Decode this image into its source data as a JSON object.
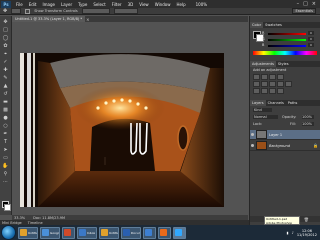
{
  "menubar": {
    "logo": "Ps",
    "items": [
      "File",
      "Edit",
      "Image",
      "Layer",
      "Type",
      "Select",
      "Filter",
      "3D",
      "View",
      "Window",
      "Help"
    ],
    "zoom": "100%"
  },
  "optionsbar": {
    "checkbox_label": "Show Transform Controls",
    "workspace": "Essentials"
  },
  "document": {
    "tab_label": "Untitled-1 @ 33.3% (Layer 1, RGB/8) *",
    "status_zoom": "33.3%",
    "status_doc": "Doc: 11.8M/23.9M",
    "mini_bridge": "Mini Bridge",
    "timeline": "Timeline"
  },
  "panels": {
    "color_tabs": [
      "Color",
      "Swatches"
    ],
    "color_sliders": [
      {
        "label": "R",
        "value": "0",
        "gradient": "#ff0000"
      },
      {
        "label": "G",
        "value": "0",
        "gradient": "#00ff00"
      },
      {
        "label": "B",
        "value": "0",
        "gradient": "#0000ff"
      }
    ],
    "adjust_tabs": [
      "Adjustments",
      "Styles"
    ],
    "adjust_title": "Add an adjustment",
    "layer_tabs": [
      "Layers",
      "Channels",
      "Paths"
    ],
    "kind": "Kind",
    "blend_mode": "Normal",
    "opacity_label": "Opacity:",
    "opacity_value": "100%",
    "lock_label": "Lock:",
    "fill_label": "Fill:",
    "fill_value": "100%",
    "layers": [
      {
        "name": "Layer 1",
        "thumb_color": "#777777",
        "selected": true
      },
      {
        "name": "Background",
        "thumb_color": "#9a4f18",
        "selected": false
      }
    ]
  },
  "taskbar": {
    "items": [
      {
        "label": "Untitled - Paint",
        "icon_color": "#e0a12c"
      },
      {
        "label": "Google - Wind...",
        "icon_color": "#4a90d9"
      },
      {
        "label": "",
        "icon_color": "#d04a2a"
      },
      {
        "label": "Inbox - Outl...",
        "icon_color": "#3b78c6"
      },
      {
        "label": "Untitled - Pai...",
        "icon_color": "#e0a12c"
      },
      {
        "label": "Docum...",
        "icon_color": "#2a5fb0"
      },
      {
        "label": "",
        "icon_color": "#3d7fd1"
      },
      {
        "label": "",
        "icon_color": "#ea6a1b"
      },
      {
        "label": "",
        "icon_color": "#31a8ff"
      }
    ],
    "time": "12:06",
    "date": "11/19/2012"
  },
  "tooltip": {
    "line1": "Untitled-1.psd",
    "line2": "Adobe Photoshop CS6"
  },
  "colors": {
    "accent": "#31a8ff",
    "warm_light": "#ffb33a"
  }
}
